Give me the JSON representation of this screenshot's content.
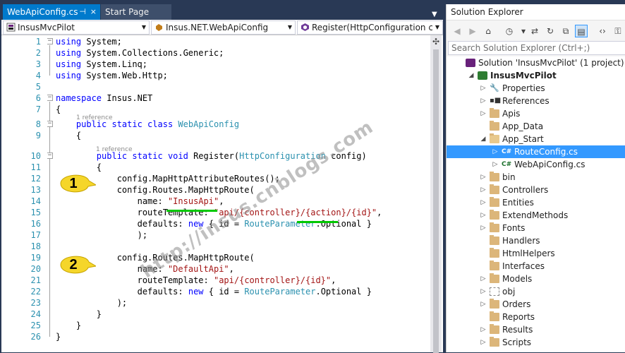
{
  "tabs": {
    "active": "WebApiConfig.cs",
    "start": "Start Page",
    "pin_icon": "⊣",
    "close_icon": "×"
  },
  "navbar": {
    "project": "InsusMvcPilot",
    "class": "Insus.NET.WebApiConfig",
    "member": "Register(HttpConfiguration config)"
  },
  "code": {
    "lines": [
      {
        "n": "1",
        "t": [
          [
            "kw",
            "using"
          ],
          [
            "",
            "System;"
          ]
        ]
      },
      {
        "n": "2",
        "t": [
          [
            "kw",
            "using"
          ],
          [
            "",
            "System.Collections.Generic;"
          ]
        ]
      },
      {
        "n": "3",
        "t": [
          [
            "kw",
            "using"
          ],
          [
            "",
            "System.Linq;"
          ]
        ]
      },
      {
        "n": "4",
        "t": [
          [
            "kw",
            "using"
          ],
          [
            "",
            "System.Web.Http;"
          ]
        ]
      },
      {
        "n": "5",
        "t": []
      },
      {
        "n": "6",
        "t": [
          [
            "kw",
            "namespace"
          ],
          [
            "",
            " Insus.NET"
          ]
        ]
      },
      {
        "n": "7",
        "t": [
          [
            "",
            "{"
          ]
        ]
      },
      {
        "n": "8",
        "t": [
          [
            "",
            "    "
          ],
          [
            "kw",
            "public static class"
          ],
          [
            "",
            " "
          ],
          [
            "ty",
            "WebApiConfig"
          ]
        ]
      },
      {
        "n": "9",
        "t": [
          [
            "",
            "    {"
          ]
        ]
      },
      {
        "n": "10",
        "t": [
          [
            "",
            "        "
          ],
          [
            "kw",
            "public static void"
          ],
          [
            "",
            " Register("
          ],
          [
            "ty",
            "HttpConfiguration"
          ],
          [
            "",
            " config)"
          ]
        ]
      },
      {
        "n": "11",
        "t": [
          [
            "",
            "        {"
          ]
        ]
      },
      {
        "n": "12",
        "t": [
          [
            "",
            "            config.MapHttpAttributeRoutes();"
          ]
        ]
      },
      {
        "n": "13",
        "t": [
          [
            "",
            "            config.Routes.MapHttpRoute("
          ]
        ]
      },
      {
        "n": "14",
        "t": [
          [
            "",
            "                name: "
          ],
          [
            "st",
            "\"InsusApi\""
          ],
          [
            "",
            ","
          ]
        ]
      },
      {
        "n": "15",
        "t": [
          [
            "",
            "                routeTemplate: "
          ],
          [
            "st",
            "\"api/{controller}/{action}/{id}\""
          ],
          [
            "",
            ","
          ]
        ]
      },
      {
        "n": "16",
        "t": [
          [
            "",
            "                defaults: "
          ],
          [
            "kw",
            "new"
          ],
          [
            "",
            " { id = "
          ],
          [
            "ty",
            "RouteParameter"
          ],
          [
            "",
            ".Optional }"
          ]
        ]
      },
      {
        "n": "17",
        "t": [
          [
            "",
            "                );"
          ]
        ]
      },
      {
        "n": "18",
        "t": []
      },
      {
        "n": "19",
        "t": [
          [
            "",
            "            config.Routes.MapHttpRoute("
          ]
        ]
      },
      {
        "n": "20",
        "t": [
          [
            "",
            "                name: "
          ],
          [
            "st",
            "\"DefaultApi\""
          ],
          [
            "",
            ","
          ]
        ]
      },
      {
        "n": "21",
        "t": [
          [
            "",
            "                routeTemplate: "
          ],
          [
            "st",
            "\"api/{controller}/{id}\""
          ],
          [
            "",
            ","
          ]
        ]
      },
      {
        "n": "22",
        "t": [
          [
            "",
            "                defaults: "
          ],
          [
            "kw",
            "new"
          ],
          [
            "",
            " { id = "
          ],
          [
            "ty",
            "RouteParameter"
          ],
          [
            "",
            ".Optional }"
          ]
        ]
      },
      {
        "n": "23",
        "t": [
          [
            "",
            "            );"
          ]
        ]
      },
      {
        "n": "24",
        "t": [
          [
            "",
            "        }"
          ]
        ]
      },
      {
        "n": "25",
        "t": [
          [
            "",
            "    }"
          ]
        ]
      },
      {
        "n": "26",
        "t": [
          [
            "",
            "}"
          ]
        ]
      }
    ],
    "reference_label_1": "1 reference",
    "reference_label_2": "1 reference"
  },
  "callouts": {
    "first": "1",
    "second": "2"
  },
  "watermark": "http://insus.cnblogs.com",
  "solution_explorer": {
    "title": "Solution Explorer",
    "search_placeholder": "Search Solution Explorer (Ctrl+;)",
    "toolbar_icons": [
      "back-icon",
      "forward-icon",
      "home-icon",
      "history-icon",
      "sync-icon",
      "refresh-icon",
      "collapse-all-icon",
      "show-all-files-icon",
      "view-code-icon",
      "properties-icon"
    ],
    "items": [
      {
        "label": "Solution 'InsusMvcPilot' (1 project)",
        "icon": "solution-icon",
        "indent": 0,
        "expander": "",
        "bold": false
      },
      {
        "label": "InsusMvcPilot",
        "icon": "web-project-icon",
        "indent": 1,
        "expander": "expanded",
        "bold": true
      },
      {
        "label": "Properties",
        "icon": "wrench-icon",
        "indent": 2,
        "expander": "collapsed",
        "bold": false
      },
      {
        "label": "References",
        "icon": "references-icon",
        "indent": 2,
        "expander": "collapsed",
        "bold": false
      },
      {
        "label": "Apis",
        "icon": "folder-icon",
        "indent": 2,
        "expander": "collapsed",
        "bold": false
      },
      {
        "label": "App_Data",
        "icon": "folder-icon",
        "indent": 2,
        "expander": "",
        "bold": false
      },
      {
        "label": "App_Start",
        "icon": "open-folder-icon",
        "indent": 2,
        "expander": "expanded",
        "bold": false
      },
      {
        "label": "RouteConfig.cs",
        "icon": "csharp-file-icon",
        "indent": 3,
        "expander": "collapsed",
        "bold": false,
        "selected": true
      },
      {
        "label": "WebApiConfig.cs",
        "icon": "csharp-file-icon",
        "indent": 3,
        "expander": "collapsed",
        "bold": false
      },
      {
        "label": "bin",
        "icon": "folder-icon",
        "indent": 2,
        "expander": "collapsed",
        "bold": false
      },
      {
        "label": "Controllers",
        "icon": "folder-icon",
        "indent": 2,
        "expander": "collapsed",
        "bold": false
      },
      {
        "label": "Entities",
        "icon": "folder-icon",
        "indent": 2,
        "expander": "collapsed",
        "bold": false
      },
      {
        "label": "ExtendMethods",
        "icon": "folder-icon",
        "indent": 2,
        "expander": "collapsed",
        "bold": false
      },
      {
        "label": "Fonts",
        "icon": "folder-icon",
        "indent": 2,
        "expander": "collapsed",
        "bold": false
      },
      {
        "label": "Handlers",
        "icon": "folder-icon",
        "indent": 2,
        "expander": "",
        "bold": false
      },
      {
        "label": "HtmlHelpers",
        "icon": "folder-icon",
        "indent": 2,
        "expander": "",
        "bold": false
      },
      {
        "label": "Interfaces",
        "icon": "folder-icon",
        "indent": 2,
        "expander": "",
        "bold": false
      },
      {
        "label": "Models",
        "icon": "folder-icon",
        "indent": 2,
        "expander": "collapsed",
        "bold": false
      },
      {
        "label": "obj",
        "icon": "hidden-folder-icon",
        "indent": 2,
        "expander": "collapsed",
        "bold": false
      },
      {
        "label": "Orders",
        "icon": "folder-icon",
        "indent": 2,
        "expander": "collapsed",
        "bold": false
      },
      {
        "label": "Reports",
        "icon": "folder-icon",
        "indent": 2,
        "expander": "",
        "bold": false
      },
      {
        "label": "Results",
        "icon": "folder-icon",
        "indent": 2,
        "expander": "collapsed",
        "bold": false
      },
      {
        "label": "Scripts",
        "icon": "folder-icon",
        "indent": 2,
        "expander": "collapsed",
        "bold": false
      }
    ]
  }
}
